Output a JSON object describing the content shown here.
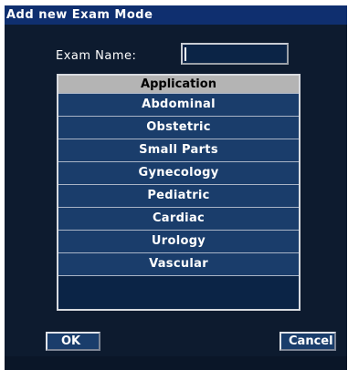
{
  "dialog": {
    "title": "Add new Exam Mode",
    "exam_name_label": "Exam Name:",
    "exam_name_value": ""
  },
  "application_list": {
    "header": "Application",
    "items": [
      {
        "label": "Abdominal"
      },
      {
        "label": "Obstetric"
      },
      {
        "label": "Small Parts"
      },
      {
        "label": "Gynecology"
      },
      {
        "label": "Pediatric"
      },
      {
        "label": "Cardiac"
      },
      {
        "label": "Urology"
      },
      {
        "label": "Vascular"
      }
    ]
  },
  "buttons": {
    "ok_label": "OK",
    "cancel_label": "Cancel"
  },
  "colors": {
    "titlebar": "#0f2f6f",
    "background": "#0d1b2f",
    "item": "#1a3d6b",
    "header": "#b4b4b4"
  }
}
